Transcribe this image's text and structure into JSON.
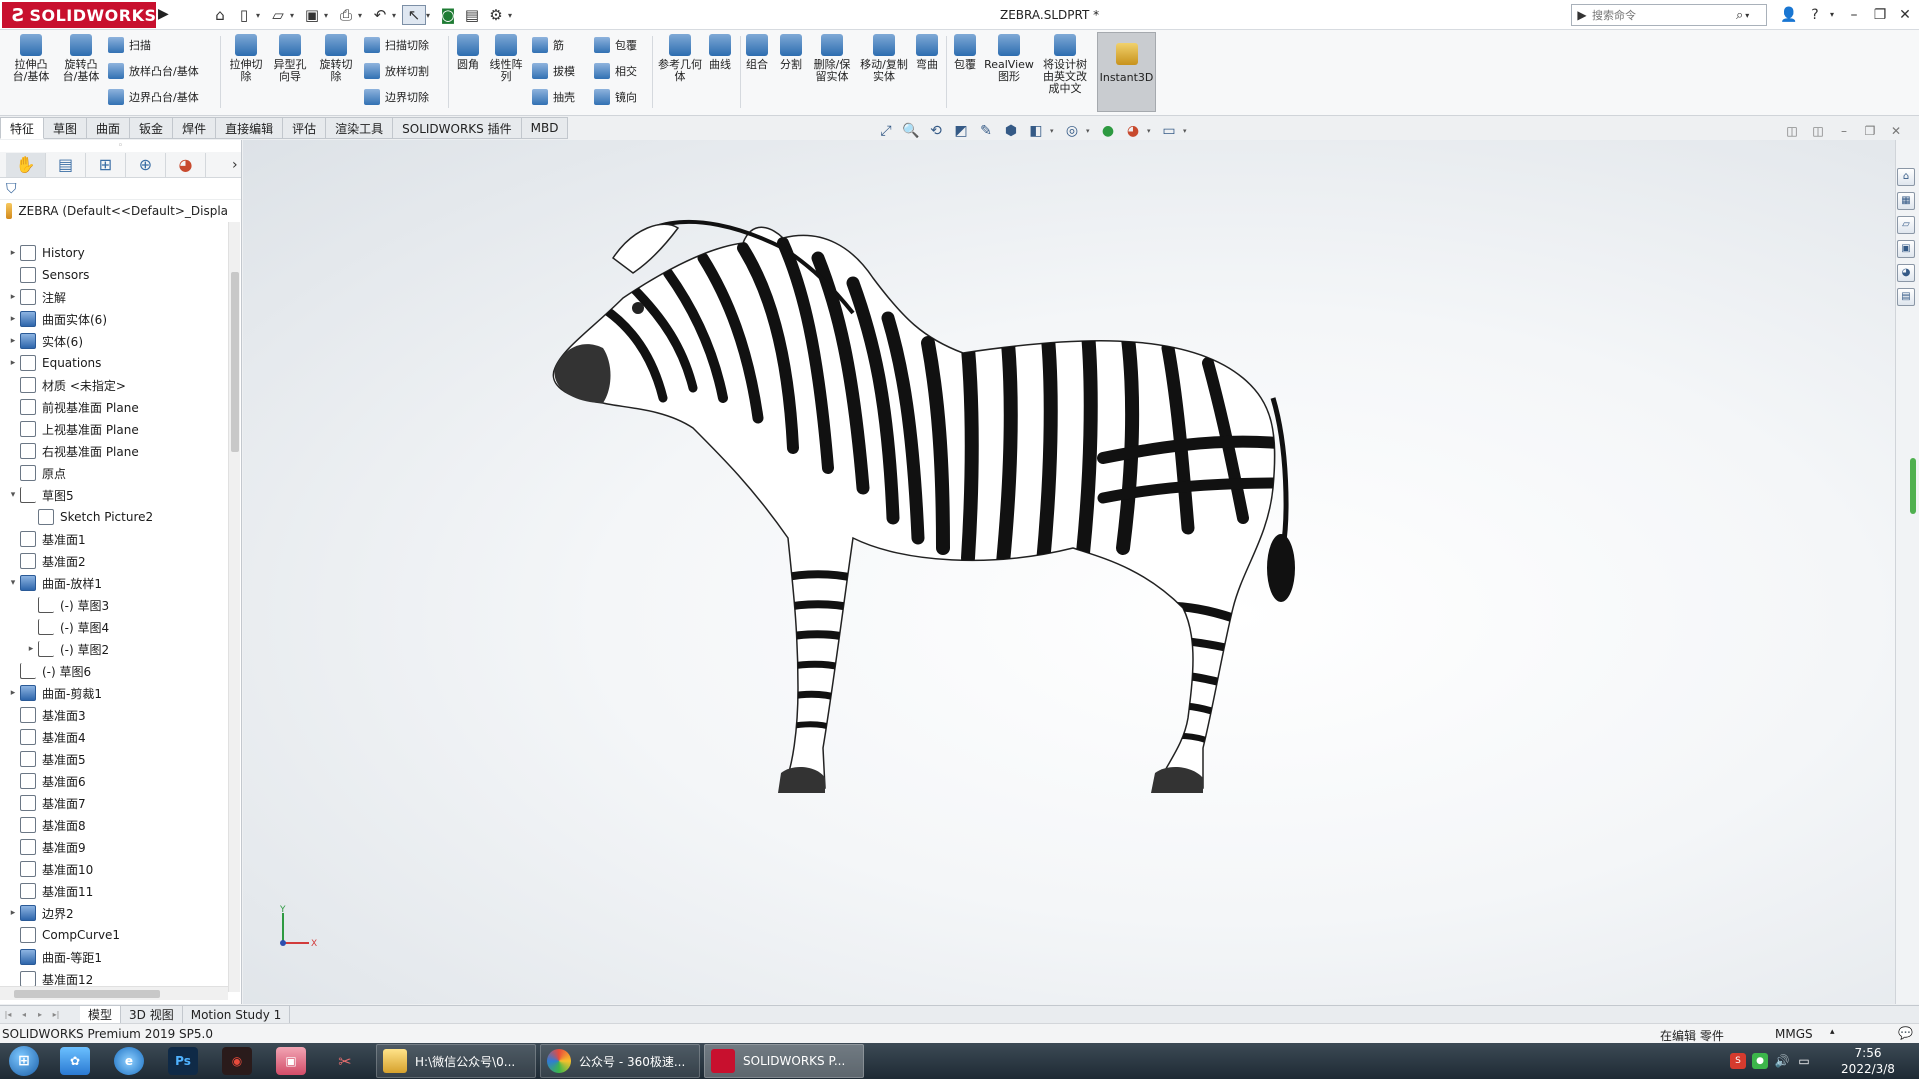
{
  "app": {
    "logo_text": "SOLIDWORKS",
    "document_title": "ZEBRA.SLDPRT *"
  },
  "search": {
    "placeholder": "搜索命令"
  },
  "ribbon": {
    "large": [
      {
        "label": "拉伸凸台/基体"
      },
      {
        "label": "旋转凸台/基体"
      },
      {
        "label": "拉伸切除"
      },
      {
        "label": "异型孔向导"
      },
      {
        "label": "旋转切除"
      },
      {
        "label": "圆角"
      },
      {
        "label": "线性阵列"
      },
      {
        "label": "参考几何体"
      },
      {
        "label": "曲线"
      },
      {
        "label": "组合"
      },
      {
        "label": "分割"
      },
      {
        "label": "删除/保留实体"
      },
      {
        "label": "移动/复制实体"
      },
      {
        "label": "弯曲"
      },
      {
        "label": "包覆"
      },
      {
        "label": "RealView 图形"
      },
      {
        "label": "将设计树由英文改成中文"
      }
    ],
    "small_group1": [
      "扫描",
      "放样凸台/基体",
      "边界凸台/基体"
    ],
    "small_group2": [
      "扫描切除",
      "放样切割",
      "边界切除"
    ],
    "small_group3": [
      "筋",
      "拔模",
      "抽壳"
    ],
    "small_group4": [
      "包覆",
      "相交",
      "镜向"
    ],
    "instant3d": "Instant3D"
  },
  "command_tabs": [
    "特征",
    "草图",
    "曲面",
    "钣金",
    "焊件",
    "直接编辑",
    "评估",
    "渲染工具",
    "SOLIDWORKS 插件",
    "MBD"
  ],
  "feature_manager": {
    "root": "ZEBRA  (Default<<Default>_Displa",
    "tree": [
      {
        "label": "History",
        "expander": "▸",
        "indent": 0
      },
      {
        "label": "Sensors",
        "expander": "",
        "indent": 0
      },
      {
        "label": "注解",
        "expander": "▸",
        "indent": 0
      },
      {
        "label": "曲面实体(6)",
        "expander": "▸",
        "indent": 0
      },
      {
        "label": "实体(6)",
        "expander": "▸",
        "indent": 0
      },
      {
        "label": "Equations",
        "expander": "▸",
        "indent": 0
      },
      {
        "label": "材质 <未指定>",
        "expander": "",
        "indent": 0
      },
      {
        "label": "前视基准面 Plane",
        "expander": "",
        "indent": 0
      },
      {
        "label": "上视基准面 Plane",
        "expander": "",
        "indent": 0
      },
      {
        "label": "右视基准面 Plane",
        "expander": "",
        "indent": 0
      },
      {
        "label": "原点",
        "expander": "",
        "indent": 0
      },
      {
        "label": "草图5",
        "expander": "▾",
        "indent": 0
      },
      {
        "label": "Sketch Picture2",
        "expander": "",
        "indent": 1
      },
      {
        "label": "基准面1",
        "expander": "",
        "indent": 0
      },
      {
        "label": "基准面2",
        "expander": "",
        "indent": 0
      },
      {
        "label": "曲面-放样1",
        "expander": "▾",
        "indent": 0
      },
      {
        "label": "(-) 草图3",
        "expander": "",
        "indent": 1
      },
      {
        "label": "(-) 草图4",
        "expander": "",
        "indent": 1
      },
      {
        "label": "(-) 草图2",
        "expander": "▸",
        "indent": 1
      },
      {
        "label": "(-) 草图6",
        "expander": "",
        "indent": 0
      },
      {
        "label": "曲面-剪裁1",
        "expander": "▸",
        "indent": 0
      },
      {
        "label": "基准面3",
        "expander": "",
        "indent": 0
      },
      {
        "label": "基准面4",
        "expander": "",
        "indent": 0
      },
      {
        "label": "基准面5",
        "expander": "",
        "indent": 0
      },
      {
        "label": "基准面6",
        "expander": "",
        "indent": 0
      },
      {
        "label": "基准面7",
        "expander": "",
        "indent": 0
      },
      {
        "label": "基准面8",
        "expander": "",
        "indent": 0
      },
      {
        "label": "基准面9",
        "expander": "",
        "indent": 0
      },
      {
        "label": "基准面10",
        "expander": "",
        "indent": 0
      },
      {
        "label": "基准面11",
        "expander": "",
        "indent": 0
      },
      {
        "label": "边界2",
        "expander": "▸",
        "indent": 0
      },
      {
        "label": "CompCurve1",
        "expander": "",
        "indent": 0
      },
      {
        "label": "曲面-等距1",
        "expander": "",
        "indent": 0
      },
      {
        "label": "基准面12",
        "expander": "",
        "indent": 0
      }
    ]
  },
  "triad": {
    "y": "Y",
    "x": "X"
  },
  "bottom_tabs": [
    "模型",
    "3D 视图",
    "Motion Study 1"
  ],
  "status": {
    "product": "SOLIDWORKS Premium 2019 SP5.0",
    "editing": "在编辑 零件",
    "units": "MMGS"
  },
  "taskbar": {
    "tasks": [
      "H:\\微信公众号\\0...",
      "公众号 - 360极速...",
      "SOLIDWORKS P..."
    ],
    "time": "7:56",
    "date": "2022/3/8"
  },
  "colors": {
    "brand": "#c8102e",
    "accent": "#2d6db0"
  }
}
